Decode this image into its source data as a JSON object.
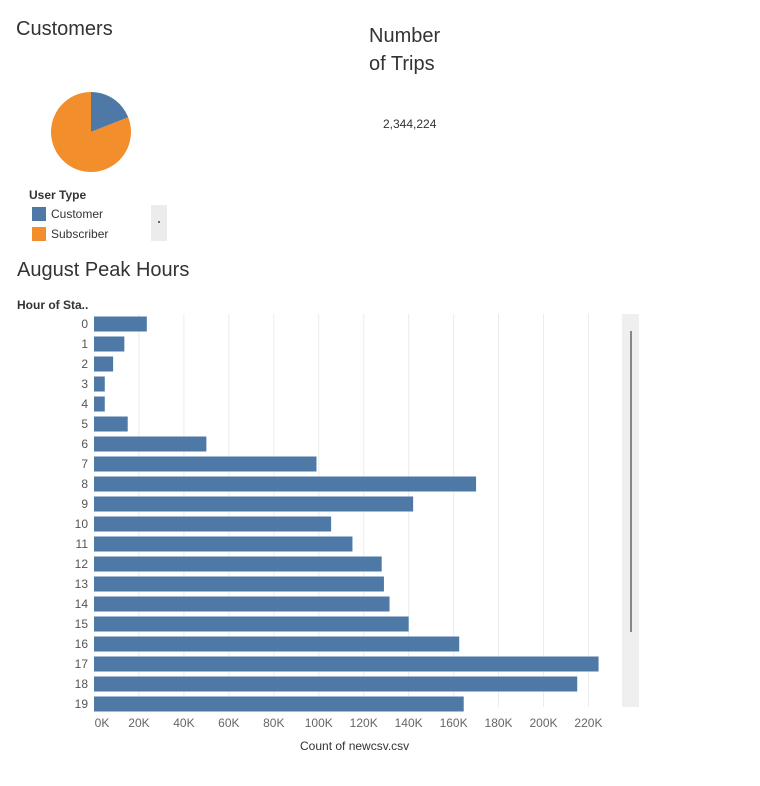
{
  "customers": {
    "title": "Customers",
    "legend_title": "User Type",
    "legend": [
      {
        "label": "Customer",
        "color": "#4e79a7"
      },
      {
        "label": "Subscriber",
        "color": "#f28e2b"
      }
    ]
  },
  "trips": {
    "title": "Number of Trips",
    "value": "2,344,224"
  },
  "chart_data": [
    {
      "type": "pie",
      "categories": [
        "Customer",
        "Subscriber"
      ],
      "values": [
        0.19,
        0.81
      ],
      "colors": [
        "#4e79a7",
        "#f28e2b"
      ]
    },
    {
      "type": "bar",
      "title": "August Peak Hours",
      "ylabel": "Hour of Sta..",
      "xlabel": "Count of newcsv.csv",
      "categories": [
        "0",
        "1",
        "2",
        "3",
        "4",
        "5",
        "6",
        "7",
        "8",
        "9",
        "10",
        "11",
        "12",
        "13",
        "14",
        "15",
        "16",
        "17",
        "18",
        "19"
      ],
      "values": [
        23500,
        13500,
        8500,
        4800,
        4800,
        15000,
        50000,
        99000,
        170000,
        142000,
        105500,
        115000,
        128000,
        129000,
        131500,
        140000,
        162500,
        224500,
        215000,
        164500
      ],
      "xticks": [
        "0K",
        "20K",
        "40K",
        "60K",
        "80K",
        "100K",
        "120K",
        "140K",
        "160K",
        "180K",
        "200K",
        "220K"
      ],
      "xlim": [
        0,
        240000
      ],
      "color": "#4e79a7",
      "grid": true
    }
  ]
}
